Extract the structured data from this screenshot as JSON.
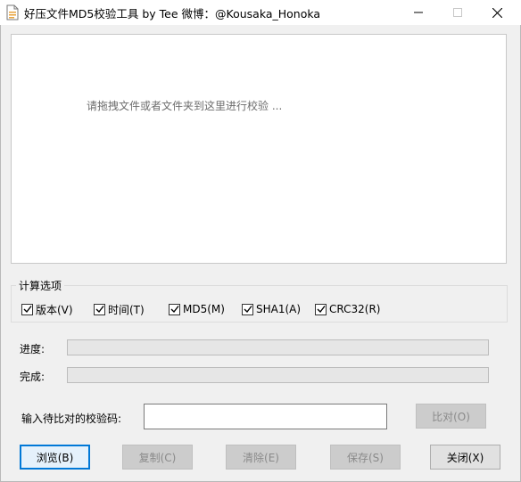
{
  "window": {
    "title": "好压文件MD5校验工具 by Tee     微博：@Kousaka_Honoka"
  },
  "drop_area": {
    "hint": "请拖拽文件或者文件夹到这里进行校验 ..."
  },
  "options": {
    "group_label": "计算选项",
    "checkboxes": [
      {
        "label": "版本(V)",
        "checked": true
      },
      {
        "label": "时间(T)",
        "checked": true
      },
      {
        "label": "MD5(M)",
        "checked": true
      },
      {
        "label": "SHA1(A)",
        "checked": true
      },
      {
        "label": "CRC32(R)",
        "checked": true
      }
    ]
  },
  "progress": {
    "progress_label": "进度:",
    "progress_value": 0,
    "done_label": "完成:",
    "done_value": 0
  },
  "compare": {
    "input_label": "输入待比对的校验码:",
    "input_value": "",
    "button_label": "比对(O)"
  },
  "buttons": {
    "browse": "浏览(B)",
    "copy": "复制(C)",
    "clear": "清除(E)",
    "save": "保存(S)",
    "close": "关闭(X)"
  },
  "colors": {
    "accent": "#0078d7",
    "progress_fill": "#06b025"
  }
}
